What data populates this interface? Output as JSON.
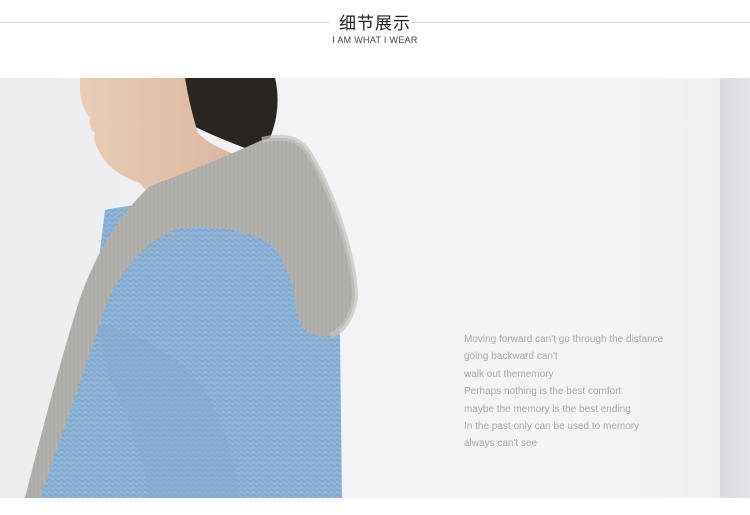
{
  "header": {
    "title": "细节展示",
    "subtitle": "I AM WHAT I WEAR"
  },
  "photo": {
    "description_colors": {
      "sweater_blue": "#8fb3d3",
      "hood_gray": "#b3b1ae",
      "hair": "#2a2522",
      "skin": "#e2c4ad"
    }
  },
  "poem": {
    "lines": [
      "Moving forward can't go through the distance",
      "going backward can't",
      "walk out thememory",
      "Perhaps nothing is the best comfort",
      "maybe the memory is the best ending",
      "In the past only can be used to memory",
      "always can't see"
    ]
  }
}
